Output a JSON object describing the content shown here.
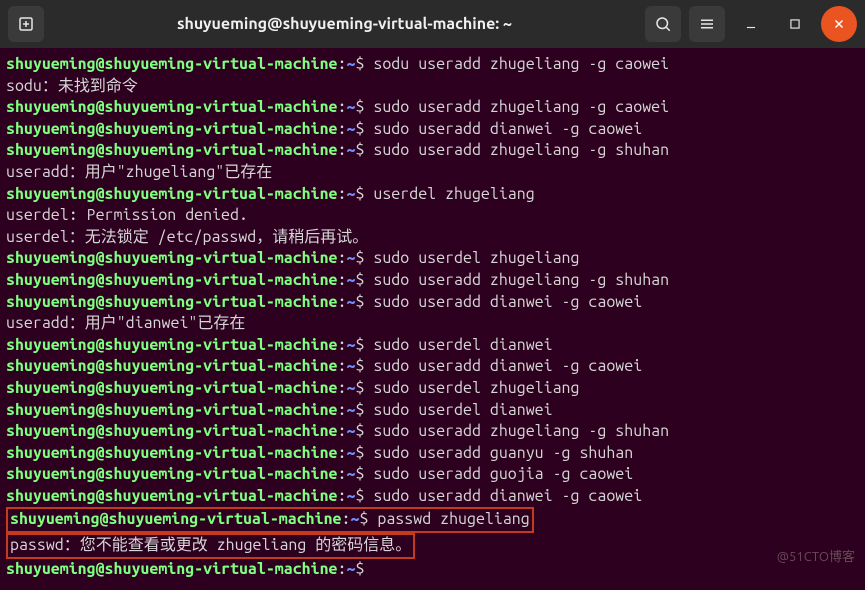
{
  "header": {
    "title": "shuyueming@shuyueming-virtual-machine: ~"
  },
  "prompt": {
    "user_host": "shuyueming@shuyueming-virtual-machine",
    "colon": ":",
    "path": "~",
    "symbol": "$"
  },
  "lines": [
    {
      "cmd": "sodu useradd zhugeliang -g caowei"
    },
    {
      "out": "sodu：未找到命令"
    },
    {
      "cmd": "sudo useradd zhugeliang -g caowei"
    },
    {
      "cmd": "sudo useradd dianwei -g caowei"
    },
    {
      "cmd": "sudo useradd zhugeliang -g shuhan"
    },
    {
      "out": "useradd：用户\"zhugeliang\"已存在"
    },
    {
      "cmd": "userdel zhugeliang"
    },
    {
      "out": "userdel: Permission denied."
    },
    {
      "out": "userdel：无法锁定 /etc/passwd，请稍后再试。"
    },
    {
      "cmd": "sudo userdel zhugeliang"
    },
    {
      "cmd": "sudo useradd zhugeliang -g shuhan"
    },
    {
      "cmd": "sudo useradd dianwei -g caowei"
    },
    {
      "out": "useradd：用户\"dianwei\"已存在"
    },
    {
      "cmd": "sudo userdel dianwei"
    },
    {
      "cmd": "sudo useradd dianwei -g caowei"
    },
    {
      "cmd": "sudo userdel zhugeliang"
    },
    {
      "cmd": "sudo userdel dianwei"
    },
    {
      "cmd": "sudo useradd zhugeliang -g shuhan"
    },
    {
      "cmd": "sudo useradd guanyu -g shuhan"
    },
    {
      "cmd": "sudo useradd guojia -g caowei"
    },
    {
      "cmd": "sudo useradd dianwei -g caowei"
    },
    {
      "cmd": "passwd zhugeliang",
      "boxed": true
    },
    {
      "out": "passwd：您不能查看或更改 zhugeliang 的密码信息。",
      "boxed": true
    },
    {
      "cmd": ""
    }
  ],
  "watermark": "@51CTO博客"
}
